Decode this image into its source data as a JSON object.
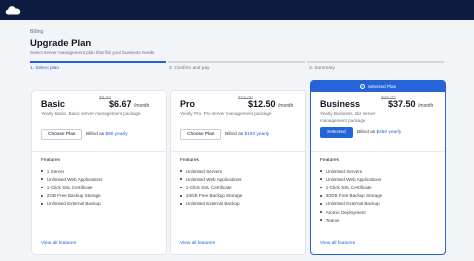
{
  "app": {
    "logo_icon": "cloud-logo-icon",
    "nav_color": "#0d1b3e",
    "accent": "#2463d8"
  },
  "breadcrumb": "Billing",
  "page_title": "Upgrade Plan",
  "page_subtitle": "Select server management plan that fits your business needs",
  "steps": [
    {
      "label": "1. Select plan",
      "active": true
    },
    {
      "label": "2. Confirm and pay",
      "active": false
    },
    {
      "label": "3. Summary",
      "active": false
    }
  ],
  "plans": [
    {
      "name": "Basic",
      "old_price": "$8.00",
      "price": "$6.67",
      "per": "/month",
      "description": "Yearly Basic. Basic server management package",
      "button": "Choose Plan",
      "billed_prefix": "Billed as ",
      "billed_amount": "$80 yearly",
      "features_title": "Features",
      "features": [
        "1 Server",
        "Unlimited Web Applications",
        "1-Click SSL Certificate",
        "2GB Free Backup Storage",
        "Unlimited External Backup"
      ],
      "view_all": "View all features",
      "selected": false
    },
    {
      "name": "Pro",
      "old_price": "$15.00",
      "price": "$12.50",
      "per": "/month",
      "description": "Yearly Pro. Pro server management package",
      "button": "Choose Plan",
      "billed_prefix": "Billed as ",
      "billed_amount": "$150 yearly",
      "features_title": "Features",
      "features": [
        "Unlimited Servers",
        "Unlimited Web Applications",
        "1-Click SSL Certificate",
        "10GB Free Backup Storage",
        "Unlimited External Backup"
      ],
      "view_all": "View all features",
      "selected": false
    },
    {
      "name": "Business",
      "old_price": "$45.00",
      "price": "$37.50",
      "per": "/month",
      "description": "Yearly Business. Biz server management package",
      "button": "Selected",
      "billed_prefix": "Billed as ",
      "billed_amount": "$450 yearly",
      "features_title": "Features",
      "features": [
        "Unlimited Servers",
        "Unlimited Web Applications",
        "1-Click SSL Certificate",
        "30GB Free Backup Storage",
        "Unlimited External Backup",
        "Atomic Deployment",
        "Teams"
      ],
      "view_all": "View all features",
      "selected": true,
      "banner": "Selected Plan"
    }
  ]
}
